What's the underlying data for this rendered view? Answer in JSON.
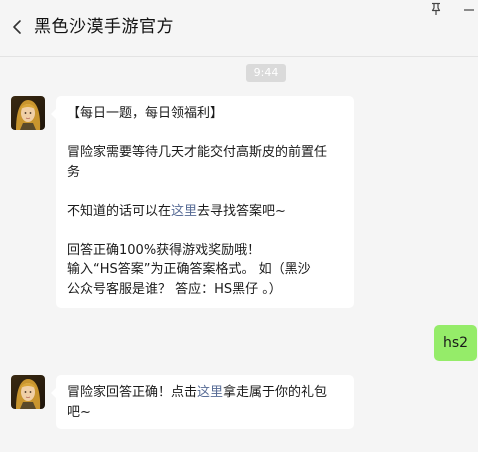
{
  "header": {
    "title": "黑色沙漠手游官方"
  },
  "timestamp": "9:44",
  "messages": {
    "first": {
      "line1": "【每日一题，每日领福利】",
      "question_line1": "冒险家需要等待几天才能交付高斯皮的前置任",
      "question_line2": "务",
      "hint_prefix": "不知道的话可以在",
      "hint_link": "这里",
      "hint_suffix": "去寻找答案吧~",
      "reward": "回答正确100%获得游戏奖励哦！",
      "format_line1": "输入“HS答案”为正确答案格式。 如（黑沙",
      "format_line2": "公众号客服是谁？ 答应：HS黑仔 。）"
    },
    "reply": {
      "text": "hs2"
    },
    "second": {
      "prefix": "冒险家回答正确！点击",
      "link": "这里",
      "suffix_line1": "拿走属于你的礼包",
      "suffix_line2": "吧~"
    }
  },
  "colors": {
    "background": "#f5f5f5",
    "incoming_bubble": "#ffffff",
    "outgoing_bubble": "#95ec69",
    "link": "#576b95",
    "time_badge": "#dadada"
  },
  "icons": {
    "back": "chevron-left-icon",
    "pin": "pin-icon",
    "minimize": "minimize-icon",
    "avatar": "avatar"
  }
}
